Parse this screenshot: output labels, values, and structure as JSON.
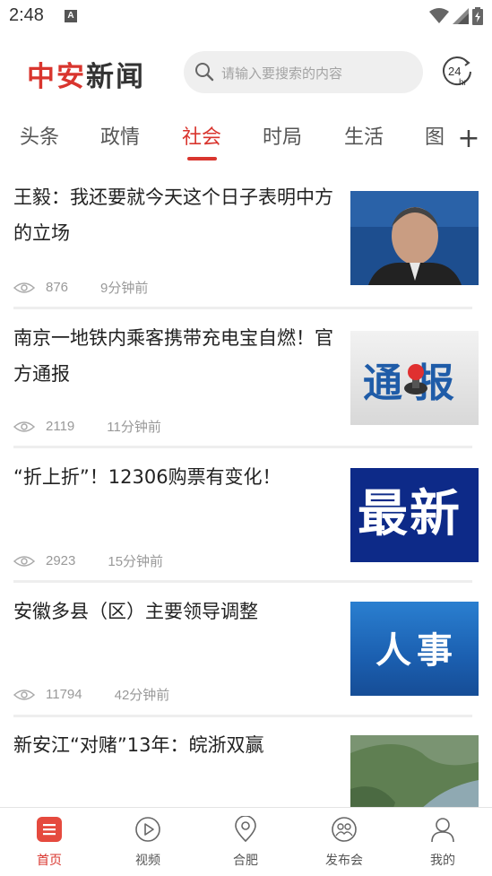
{
  "status_bar": {
    "time": "2:48",
    "badge": "A"
  },
  "header": {
    "logo_red": "中安",
    "logo_dark": "新闻",
    "search_placeholder": "请输入要搜索的内容",
    "icon_24": "24",
    "icon_hr": "hr"
  },
  "tabs": [
    {
      "label": "头条"
    },
    {
      "label": "政情"
    },
    {
      "label": "社会"
    },
    {
      "label": "时局"
    },
    {
      "label": "生活"
    },
    {
      "label": "图"
    }
  ],
  "active_tab": "社会",
  "news": [
    {
      "title": "王毅：我还要就今天这个日子表明中方的立场",
      "views": "876",
      "time": "9分钟前",
      "thumb_icon": "portrait-photo-thumb"
    },
    {
      "title": "南京一地铁内乘客携带充电宝自燃！官方通报",
      "views": "2119",
      "time": "11分钟前",
      "thumb_text": "通报"
    },
    {
      "title": "“折上折”！12306购票有变化！",
      "views": "2923",
      "time": "15分钟前",
      "thumb_text": "最新"
    },
    {
      "title": "安徽多县（区）主要领导调整",
      "views": "11794",
      "time": "42分钟前",
      "thumb_text": "人事"
    },
    {
      "title": "新安江“对赌”13年：皖浙双赢",
      "thumb_icon": "river-landscape-thumb"
    }
  ],
  "bottom_nav": [
    {
      "label": "首页",
      "icon": "home-list-icon"
    },
    {
      "label": "视频",
      "icon": "play-icon"
    },
    {
      "label": "合肥",
      "icon": "location-pin-icon"
    },
    {
      "label": "发布会",
      "icon": "people-group-icon"
    },
    {
      "label": "我的",
      "icon": "person-icon"
    }
  ],
  "colors": {
    "accent": "#d9352e",
    "text": "#222222",
    "muted": "#999999"
  }
}
